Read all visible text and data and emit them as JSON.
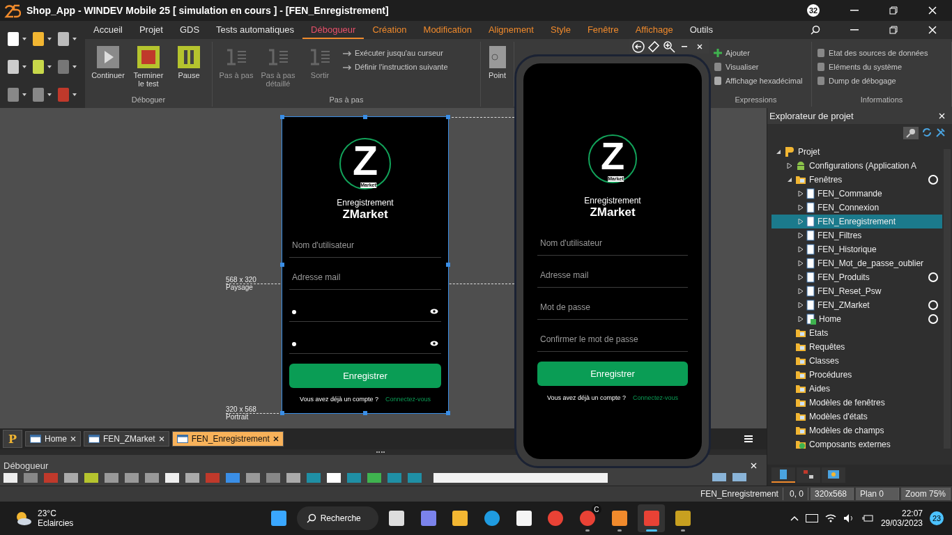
{
  "window": {
    "title": "Shop_App - WINDEV Mobile 25 [ simulation en cours ] - [FEN_Enregistrement]",
    "badge": "32"
  },
  "ribbon": {
    "tabs": [
      {
        "label": "Accueil",
        "kind": "standard",
        "selected": false
      },
      {
        "label": "Projet",
        "kind": "standard",
        "selected": false
      },
      {
        "label": "GDS",
        "kind": "standard",
        "selected": false
      },
      {
        "label": "Tests automatiques",
        "kind": "standard",
        "selected": false
      },
      {
        "label": "Débogueur",
        "kind": "standard",
        "selected": true
      },
      {
        "label": "Création",
        "kind": "contextual",
        "selected": false
      },
      {
        "label": "Modification",
        "kind": "contextual",
        "selected": false
      },
      {
        "label": "Alignement",
        "kind": "contextual",
        "selected": false
      },
      {
        "label": "Style",
        "kind": "contextual",
        "selected": false
      },
      {
        "label": "Fenêtre",
        "kind": "contextual",
        "selected": false
      },
      {
        "label": "Affichage",
        "kind": "contextual",
        "selected": false
      },
      {
        "label": "Outils",
        "kind": "standard",
        "selected": false
      }
    ],
    "groups": [
      {
        "title": "Déboguer",
        "large": [
          {
            "label": "Continuer",
            "disabled": false
          },
          {
            "label": "Terminer le test",
            "disabled": false
          },
          {
            "label": "Pause",
            "disabled": false
          }
        ]
      },
      {
        "title": "Pas à pas",
        "large": [
          {
            "label": "Pas à pas",
            "disabled": true
          },
          {
            "label": "Pas à pas détaillé",
            "disabled": true
          },
          {
            "label": "Sortir",
            "disabled": true
          }
        ],
        "small": [
          {
            "label": "Exécuter jusqu'au curseur"
          },
          {
            "label": "Définir l'instruction suivante"
          }
        ]
      },
      {
        "large": [
          {
            "label": "Point",
            "disabled": false
          }
        ]
      },
      {
        "title": "Expressions",
        "small": [
          {
            "label": "Ajouter"
          },
          {
            "label": "Visualiser"
          },
          {
            "label": "Affichage hexadécimal"
          }
        ]
      },
      {
        "title": "Informations",
        "small": [
          {
            "label": "Etat des sources de données"
          },
          {
            "label": "Eléments du système"
          },
          {
            "label": "Dump de débogage"
          }
        ]
      }
    ]
  },
  "editor": {
    "orientations": [
      {
        "size": "568 x 320",
        "name": "Paysage"
      },
      {
        "size": "320 x 568",
        "name": "Portrait"
      }
    ],
    "design": {
      "logo": {
        "letter": "Z",
        "caption": "Market"
      },
      "heading": "Enregistrement",
      "brand": "ZMarket",
      "fields": [
        {
          "kind": "text",
          "placeholder": "Nom d'utilisateur"
        },
        {
          "kind": "text",
          "placeholder": "Adresse mail"
        },
        {
          "kind": "password"
        },
        {
          "kind": "password"
        }
      ],
      "button": "Enregistrer",
      "prompt": "Vous avez déjà un compte ?",
      "link": "Connectez-vous"
    }
  },
  "simulator": {
    "logo": {
      "letter": "Z",
      "caption": "Market"
    },
    "heading": "Enregistrement",
    "brand": "ZMarket",
    "fields": [
      {
        "kind": "text",
        "placeholder": "Nom d'utilisateur"
      },
      {
        "kind": "text",
        "placeholder": "Adresse mail"
      },
      {
        "kind": "text",
        "placeholder": "Mot de passe"
      },
      {
        "kind": "text",
        "placeholder": "Confirmer le mot de passe"
      }
    ],
    "button": "Enregistrer",
    "prompt": "Vous avez déjà un compte ?",
    "link": "Connectez-vous"
  },
  "project_button": "P",
  "document_tabs": [
    {
      "label": "Home",
      "selected": false
    },
    {
      "label": "FEN_ZMarket",
      "selected": false
    },
    {
      "label": "FEN_Enregistrement",
      "selected": true
    }
  ],
  "debugger_pane": {
    "title": "Débogueur"
  },
  "explorer": {
    "title": "Explorateur de projet",
    "tree": [
      {
        "label": "Projet",
        "kind": "project",
        "expanded": true,
        "ring": false,
        "selected": false,
        "children": [
          {
            "label": "Configurations (Application A",
            "kind": "android",
            "expanded": false,
            "ring": false,
            "selected": false
          },
          {
            "label": "Fenêtres",
            "kind": "folder",
            "expanded": true,
            "ring": true,
            "selected": false,
            "children": [
              {
                "label": "FEN_Commande",
                "kind": "window",
                "expanded": false,
                "ring": false,
                "selected": false
              },
              {
                "label": "FEN_Connexion",
                "kind": "window",
                "expanded": false,
                "ring": false,
                "selected": false
              },
              {
                "label": "FEN_Enregistrement",
                "kind": "window",
                "expanded": false,
                "ring": false,
                "selected": true
              },
              {
                "label": "FEN_Filtres",
                "kind": "window",
                "expanded": false,
                "ring": false,
                "selected": false
              },
              {
                "label": "FEN_Historique",
                "kind": "window",
                "expanded": false,
                "ring": false,
                "selected": false
              },
              {
                "label": "FEN_Mot_de_passe_oublier",
                "kind": "window",
                "expanded": false,
                "ring": false,
                "selected": false
              },
              {
                "label": "FEN_Produits",
                "kind": "window",
                "expanded": false,
                "ring": true,
                "selected": false
              },
              {
                "label": "FEN_Reset_Psw",
                "kind": "window",
                "expanded": false,
                "ring": false,
                "selected": false
              },
              {
                "label": "FEN_ZMarket",
                "kind": "window",
                "expanded": false,
                "ring": true,
                "selected": false
              },
              {
                "label": "Home",
                "kind": "home-window",
                "expanded": false,
                "ring": true,
                "selected": false
              }
            ]
          },
          {
            "label": "Etats",
            "kind": "folder",
            "ring": false,
            "selected": false
          },
          {
            "label": "Requêtes",
            "kind": "folder",
            "ring": false,
            "selected": false
          },
          {
            "label": "Classes",
            "kind": "folder",
            "ring": false,
            "selected": false
          },
          {
            "label": "Procédures",
            "kind": "folder",
            "ring": false,
            "selected": false
          },
          {
            "label": "Aides",
            "kind": "folder",
            "ring": false,
            "selected": false
          },
          {
            "label": "Modèles de fenêtres",
            "kind": "folder",
            "ring": false,
            "selected": false
          },
          {
            "label": "Modèles d'états",
            "kind": "folder",
            "ring": false,
            "selected": false
          },
          {
            "label": "Modèles de champs",
            "kind": "folder",
            "ring": false,
            "selected": false
          },
          {
            "label": "Composants externes",
            "kind": "component",
            "ring": false,
            "selected": false
          }
        ]
      }
    ],
    "tabs": [
      {
        "selected": true
      },
      {
        "selected": false
      },
      {
        "selected": false
      }
    ]
  },
  "status_bar": [
    {
      "text": "FEN_Enregistrement",
      "kind": "plain"
    },
    {
      "text": "0, 0",
      "kind": "plain"
    },
    {
      "text": "320x568",
      "kind": "boxed"
    },
    {
      "text": "Plan 0",
      "kind": "boxed"
    },
    {
      "text": "Zoom 75%",
      "kind": "boxed"
    }
  ],
  "taskbar": {
    "weather": {
      "temperature": "23°C",
      "condition": "Eclaircies"
    },
    "search": "Recherche",
    "apps": [
      {
        "kind": "start",
        "running": false,
        "selected": false
      },
      {
        "kind": "taskview",
        "running": false,
        "selected": false
      },
      {
        "kind": "meet",
        "running": false,
        "selected": false
      },
      {
        "kind": "files",
        "running": false,
        "selected": false
      },
      {
        "kind": "edge",
        "running": false,
        "selected": false
      },
      {
        "kind": "store",
        "running": false,
        "selected": false
      },
      {
        "kind": "chrome",
        "running": false,
        "selected": false
      },
      {
        "kind": "chrome",
        "running": true,
        "selected": false,
        "badge": "C"
      },
      {
        "kind": "windev",
        "running": true,
        "selected": false
      },
      {
        "kind": "snip",
        "running": true,
        "selected": true
      },
      {
        "kind": "wm",
        "running": true,
        "selected": false
      }
    ],
    "time": "22:07",
    "date": "29/03/2023",
    "notifications": "23"
  }
}
